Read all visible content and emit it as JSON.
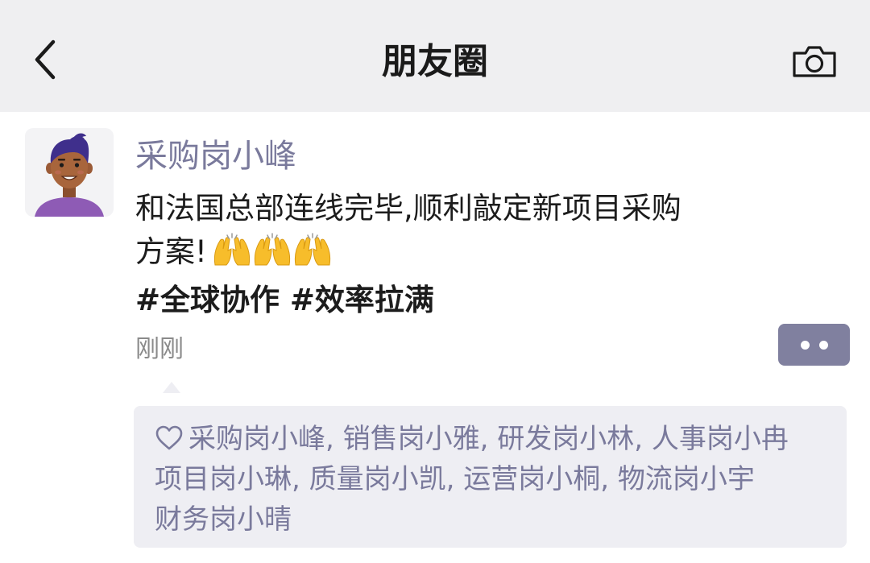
{
  "nav": {
    "title": "朋友圈",
    "back_icon": "chevron-left-icon",
    "camera_icon": "camera-icon",
    "background": "#efeff1"
  },
  "post": {
    "author": "采购岗小峰",
    "text_line1": "和法国总部连线完毕,顺利敲定新项目采购",
    "text_line2": "方案!",
    "emojis": [
      "raising-hands-emoji",
      "raising-hands-emoji",
      "raising-hands-emoji"
    ],
    "tags": "#全球协作 #效率拉满",
    "time": "刚刚",
    "more_button_color": "#80809f"
  },
  "likes": {
    "icon": "heart-outline-icon",
    "line1": "采购岗小峰, 销售岗小雅, 研发岗小林, 人事岗小冉",
    "line2": "项目岗小琳, 质量岗小凯, 运营岗小桐, 物流岗小宇",
    "line3": "财务岗小晴",
    "names": [
      "采购岗小峰",
      "销售岗小雅",
      "研发岗小林",
      "人事岗小冉",
      "项目岗小琳",
      "质量岗小凯",
      "运营岗小桐",
      "物流岗小宇",
      "财务岗小晴"
    ],
    "name_color": "#7a7a9c",
    "background": "#eeeef3"
  }
}
